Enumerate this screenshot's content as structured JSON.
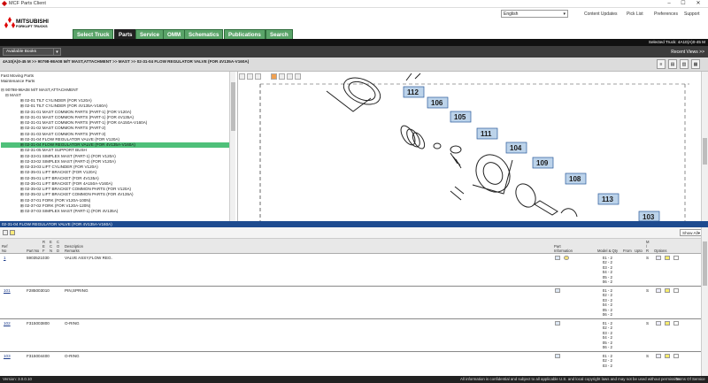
{
  "window": {
    "title": "MCF Parts Client",
    "buttons": [
      "–",
      "☐",
      "✕"
    ]
  },
  "header": {
    "brand_line1": "MITSUBISHI",
    "brand_line2": "FORKLIFT TRUCKS",
    "tabs": [
      "Select Truck",
      "Parts",
      "Service",
      "OMM",
      "Schematics",
      "Publications",
      "Search"
    ],
    "active_tab": "Parts",
    "language": "English",
    "links": [
      "Content Updates",
      "Pick List",
      "Preferences",
      "Support"
    ]
  },
  "selected_truck": "Selected Truck: 4A10(A)0-45 M",
  "books": {
    "label": "Available Books",
    "recent": "Recent Views >>"
  },
  "breadcrumb": {
    "line1": "4A10(A)0-45 M >> 90798-98A08 M/T MAST,ATTACHMENT >> MAST >> 02-31-04 FLOW REGULATOR VALVE (FOR 4V135A-V160A)",
    "line2": ""
  },
  "tree": {
    "root_links": [
      "Fast Moving Parts",
      "Maintenance Parts"
    ],
    "group": "90798-98A08 M/T MAST,ATTACHMENT",
    "sub": "MAST",
    "items": [
      "02-01 TILT CYLINDER (FOR V120A)",
      "02-01 TILT CYLINDER (FOR 4V135A-V160A)",
      "02-31-01 MAST COMMON PARTS (PART-1) (FOR V120A)",
      "02-31-01 MAST COMMON PARTS (PART-1) (FOR 4V135A)",
      "02-31-01 MAST COMMON PARTS (PART-1) (FOR 4A150A-V160A)",
      "02-31-02 MAST COMMON PARTS (PART-2)",
      "02-31-03 MAST COMMON PARTS (PART-3)",
      "02-31-04 FLOW REGULATOR VALVE (FOR V120A)",
      "02-31-04 FLOW REGULATOR VALVE (FOR 4V135A-V160A)",
      "02-31-05 MAST SUPPORT BUSH",
      "02-33-01 SIMPLEX MAST (PART-1) (FOR V120A)",
      "02-33-02 SIMPLEX MAST (PART-2) (FOR V120A)",
      "02-33-03 LIFT CYLINDER (FOR V120A)",
      "02-35-01 LIFT BRACKET (FOR V120A)",
      "02-35-01 LIFT BRACKET (FOR 4V135A)",
      "02-35-01 LIFT BRACKET (FOR 4A150A-V160A)",
      "02-35-02 LIFT BRACKET COMMON PARTS (FOR V120A)",
      "02-35-02 LIFT BRACKET COMMON PARTS (FOR 4V135A)",
      "02-37-01 FORK (FOR V120A-100N)",
      "02-37-02 FORK (FOR V120A-120N)",
      "02-37-03 SIMPLEX MAST (PART-1) (FOR 4V135A)"
    ],
    "selected_index": 8
  },
  "diagram": {
    "callouts": [
      "112",
      "106",
      "105",
      "111",
      "104",
      "109",
      "108",
      "113",
      "103"
    ]
  },
  "lower": {
    "title": "02-31-04 FLOW REGULATOR VALVE (FOR 4V135A-V160A)",
    "show_all": "Show All",
    "columns": {
      "ref": "Ref\nNo",
      "part": "Part No",
      "r": "R\nE\nF",
      "e": "E\nC\nN",
      "c": "C\nO\nD",
      "desc": "Description\nRemarks",
      "info": "Part\nInformation",
      "model": "Model & Qty",
      "from": "From",
      "upto": "Upto",
      "mr": "M\n/\nR",
      "options": "Options"
    },
    "rows": [
      {
        "ref": "1",
        "part": "5903521030",
        "desc": "VALVE ASSY,FLOW REG.",
        "mr": "S",
        "qty": [
          "01 - 2",
          "02 - 2",
          "03 - 2",
          "04 - 2",
          "05 - 2",
          "06 - 2"
        ]
      },
      {
        "ref": "101",
        "part": "F285003010",
        "desc": "PIN,SPRING",
        "mr": "S",
        "qty": [
          "01 - 2",
          "02 - 2",
          "03 - 2",
          "04 - 2",
          "05 - 2",
          "06 - 2"
        ]
      },
      {
        "ref": "102",
        "part": "F315003800",
        "desc": "O-RING",
        "mr": "S",
        "qty": [
          "01 - 2",
          "02 - 2",
          "03 - 2",
          "04 - 2",
          "05 - 2",
          "06 - 2"
        ]
      },
      {
        "ref": "103",
        "part": "F315004400",
        "desc": "O-RING",
        "mr": "S",
        "qty": [
          "01 - 2",
          "02 - 2",
          "03 - 2"
        ]
      }
    ]
  },
  "footer": {
    "version": "Version: 3.0.0.10",
    "notice": "All information is confidential and subject to all applicable U.S. and local copyright laws and may not be used without permission.",
    "terms": "Terms Of Service"
  },
  "colors": {
    "tab_green": "#5aa469",
    "highlight": "#4fc07a",
    "title_blue": "#1e4b8f"
  }
}
